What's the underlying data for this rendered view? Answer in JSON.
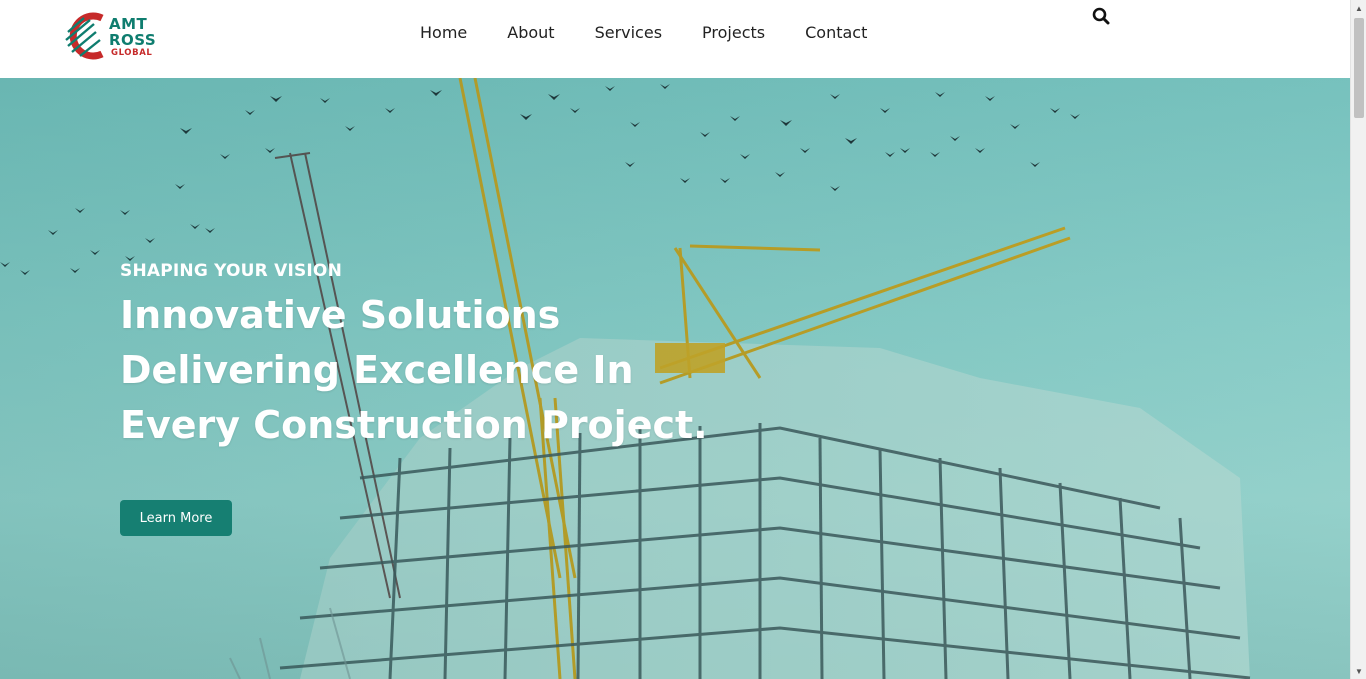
{
  "brand": {
    "line1": "AMT",
    "line2": "ROSS",
    "tagline": "GLOBAL",
    "colors": {
      "teal": "#0f7d6f",
      "red": "#c62a2a"
    }
  },
  "nav": {
    "items": [
      "Home",
      "About",
      "Services",
      "Projects",
      "Contact"
    ]
  },
  "search": {
    "icon": "search-icon"
  },
  "hero": {
    "eyebrow": "SHAPING YOUR VISION",
    "headline_line1": "Innovative Solutions",
    "headline_line2": "Delivering Excellence In",
    "headline_line3": "Every Construction Project.",
    "cta_label": "Learn More",
    "accent_color": "#167f72"
  }
}
